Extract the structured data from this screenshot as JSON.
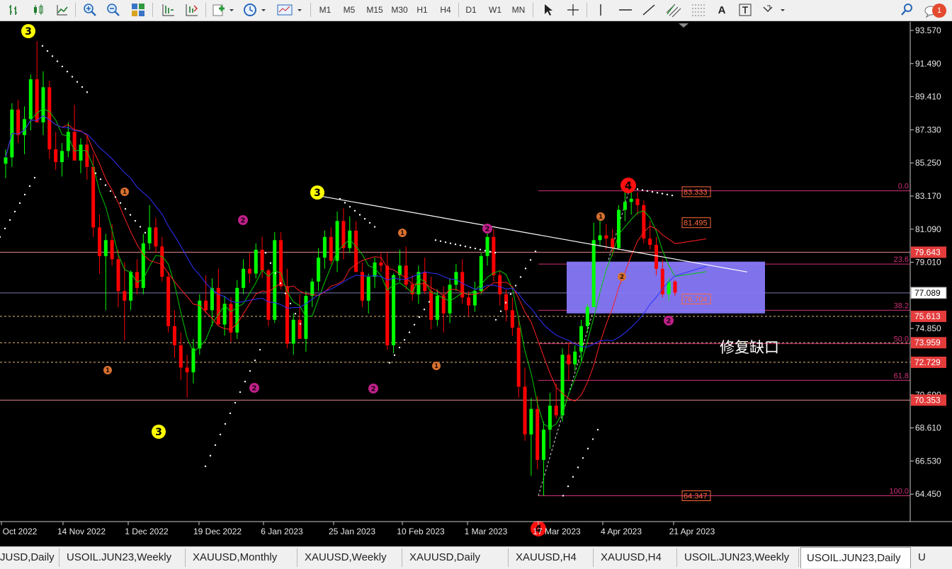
{
  "toolbar": {
    "timeframes": [
      "M1",
      "M5",
      "M15",
      "M30",
      "H1",
      "H4",
      "D1",
      "W1",
      "MN"
    ],
    "notification_count": "1"
  },
  "chart_data": {
    "type": "candlestick",
    "symbol": "USOIL.JUN23",
    "timeframe": "Daily",
    "price_axis": [
      "93.570",
      "91.490",
      "89.410",
      "87.330",
      "85.250",
      "83.170",
      "81.090",
      "79.010",
      "74.850",
      "72.770",
      "70.690",
      "68.610",
      "66.530",
      "64.450"
    ],
    "date_axis": [
      "Oct 2022",
      "14 Nov 2022",
      "1 Dec 2022",
      "19 Dec 2022",
      "6 Jan 2023",
      "25 Jan 2023",
      "10 Feb 2023",
      "1 Mar 2023",
      "17 Mar 2023",
      "4 Apr 2023",
      "21 Apr 2023"
    ],
    "price_tags": [
      {
        "label": "77.089",
        "kind": "current"
      },
      {
        "label": "79.643",
        "kind": "level"
      },
      {
        "label": "75.613",
        "kind": "level"
      },
      {
        "label": "73.959",
        "kind": "level"
      },
      {
        "label": "72.729",
        "kind": "level"
      },
      {
        "label": "70.353",
        "kind": "level"
      }
    ],
    "fib_levels": [
      {
        "ratio": "0.0",
        "price": 83.5
      },
      {
        "ratio": "23.6",
        "price": 78.9
      },
      {
        "ratio": "38.2",
        "price": 76.0
      },
      {
        "ratio": "50.0",
        "price": 73.9
      },
      {
        "ratio": "61.8",
        "price": 71.6
      },
      {
        "ratio": "100.0",
        "price": 64.347
      }
    ],
    "fib_price_labels": [
      "83.333",
      "81.495",
      "76.704",
      "64.347"
    ],
    "wave_labels": [
      "3",
      "3",
      "3",
      "4",
      "4",
      "1",
      "1",
      "1",
      "1",
      "1",
      "2",
      "2",
      "2",
      "2",
      "2",
      "2"
    ],
    "annotation": "修复缺口",
    "colors": {
      "bull": "#00ff00",
      "bear": "#ff0000",
      "ma_fast": "#00c800",
      "ma_mid": "#ff2020",
      "ma_slow": "#3030ff",
      "zone": "#8a7cff",
      "fib": "#d0317a",
      "level": "#e48a8a"
    }
  },
  "tabs": [
    {
      "label": "JUSD,Daily",
      "active": false
    },
    {
      "label": "USOIL.JUN23,Weekly",
      "active": false
    },
    {
      "label": "XAUUSD,Monthly",
      "active": false
    },
    {
      "label": "XAUUSD,Weekly",
      "active": false
    },
    {
      "label": "XAUUSD,Daily",
      "active": false
    },
    {
      "label": "XAUUSD,H4",
      "active": false
    },
    {
      "label": "XAUUSD,H4",
      "active": false
    },
    {
      "label": "USOIL.JUN23,Weekly",
      "active": false
    },
    {
      "label": "USOIL.JUN23,Daily",
      "active": true
    },
    {
      "label": "U",
      "active": false
    }
  ]
}
